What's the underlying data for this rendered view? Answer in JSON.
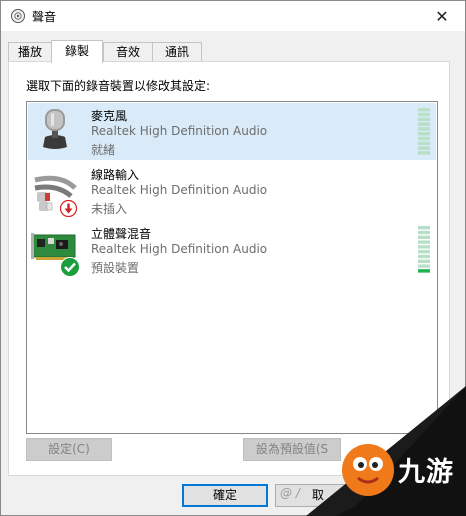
{
  "window": {
    "title": "聲音",
    "close_glyph": "✕"
  },
  "tabs": [
    {
      "label": "播放",
      "active": false
    },
    {
      "label": "錄製",
      "active": true
    },
    {
      "label": "音效",
      "active": false
    },
    {
      "label": "通訊",
      "active": false
    }
  ],
  "panel": {
    "instruction": "選取下面的錄音裝置以修改其設定:",
    "devices": [
      {
        "name": "麥克風",
        "driver": "Realtek High Definition Audio",
        "status": "就緒",
        "icon": "microphone-icon",
        "selected": true,
        "badge": null,
        "level": 0
      },
      {
        "name": "線路輸入",
        "driver": "Realtek High Definition Audio",
        "status": "未插入",
        "icon": "line-in-cable-icon",
        "selected": false,
        "badge": "unplugged-arrow-icon",
        "level": null
      },
      {
        "name": "立體聲混音",
        "driver": "Realtek High Definition Audio",
        "status": "預設裝置",
        "icon": "sound-card-icon",
        "selected": false,
        "badge": "default-check-icon",
        "level": 0.08
      }
    ]
  },
  "buttons": {
    "configure": "設定(C)",
    "set_default": "設為預設值(S",
    "ok": "確定",
    "cancel": "取"
  },
  "watermark": {
    "text": "九游",
    "small_text": "@ /"
  },
  "colors": {
    "selected_row": "#d9ebf9",
    "meter_idle": "#b8e0c8",
    "meter_active": "#1db450",
    "check_badge": "#1a9f3c",
    "arrow_badge": "#d62020"
  }
}
